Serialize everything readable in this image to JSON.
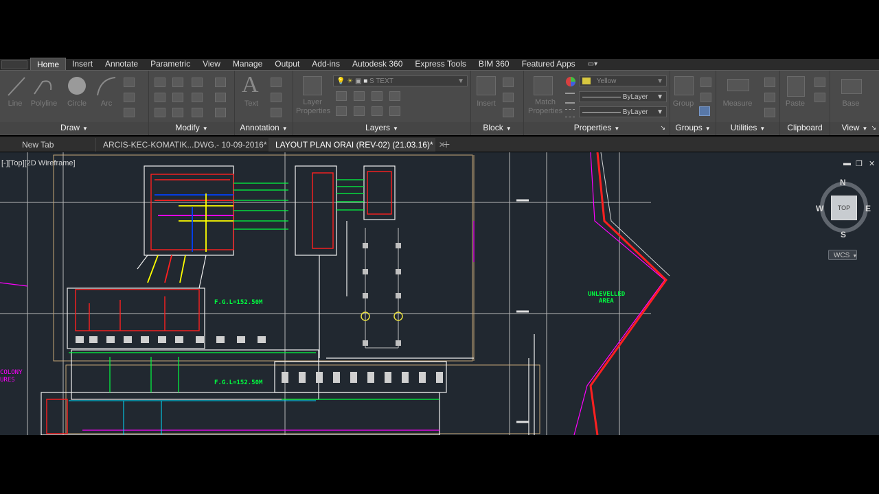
{
  "menu_tabs": [
    {
      "label": "Home"
    },
    {
      "label": "Insert"
    },
    {
      "label": "Annotate"
    },
    {
      "label": "Parametric"
    },
    {
      "label": "View"
    },
    {
      "label": "Manage"
    },
    {
      "label": "Output"
    },
    {
      "label": "Add-ins"
    },
    {
      "label": "Autodesk 360"
    },
    {
      "label": "Express Tools"
    },
    {
      "label": "BIM 360"
    },
    {
      "label": "Featured Apps"
    }
  ],
  "ribbon": {
    "draw": {
      "label": "Draw",
      "tools": [
        "Line",
        "Polyline",
        "Circle",
        "Arc"
      ]
    },
    "modify": {
      "label": "Modify"
    },
    "annotation": {
      "label": "Annotation",
      "tools": [
        "Text"
      ]
    },
    "layers": {
      "label": "Layers",
      "tools": [
        "Layer Properties"
      ],
      "current_layer": "S TEXT"
    },
    "block": {
      "label": "Block",
      "tools": [
        "Insert"
      ]
    },
    "properties": {
      "label": "Properties",
      "tools": [
        "Match Properties"
      ],
      "color": "Yellow",
      "linetype": "ByLayer",
      "lineweight": "ByLayer"
    },
    "groups": {
      "label": "Groups",
      "tools": [
        "Group"
      ]
    },
    "utilities": {
      "label": "Utilities",
      "tools": [
        "Measure"
      ]
    },
    "clipboard": {
      "label": "Clipboard",
      "tools": [
        "Paste"
      ]
    },
    "view": {
      "label": "View",
      "tools": [
        "Base"
      ]
    }
  },
  "file_tabs": [
    {
      "label": "New Tab"
    },
    {
      "label": "ARCIS-KEC-KOMATIK...DWG.- 10-09-2016*"
    },
    {
      "label": "LAYOUT PLAN ORAI (REV-02) (21.03.16)*"
    }
  ],
  "viewport": {
    "label": "[-][Top][2D Wireframe]"
  },
  "viewcube": {
    "n": "N",
    "s": "S",
    "e": "E",
    "w": "W",
    "face": "TOP",
    "wcs": "WCS"
  },
  "drawing_texts": {
    "fgl1": "F.G.L=152.50M",
    "fgl2": "F.G.L=152.50M",
    "unlevelled1": "UNLEVELLED",
    "unlevelled2": "AREA",
    "colony1": "COLONY",
    "colony2": "URES"
  },
  "colors": {
    "canvas": "#212830",
    "ribbon": "#4a4a4a",
    "green": "#00ff40",
    "red": "#ff2020",
    "magenta": "#ff00ff"
  }
}
